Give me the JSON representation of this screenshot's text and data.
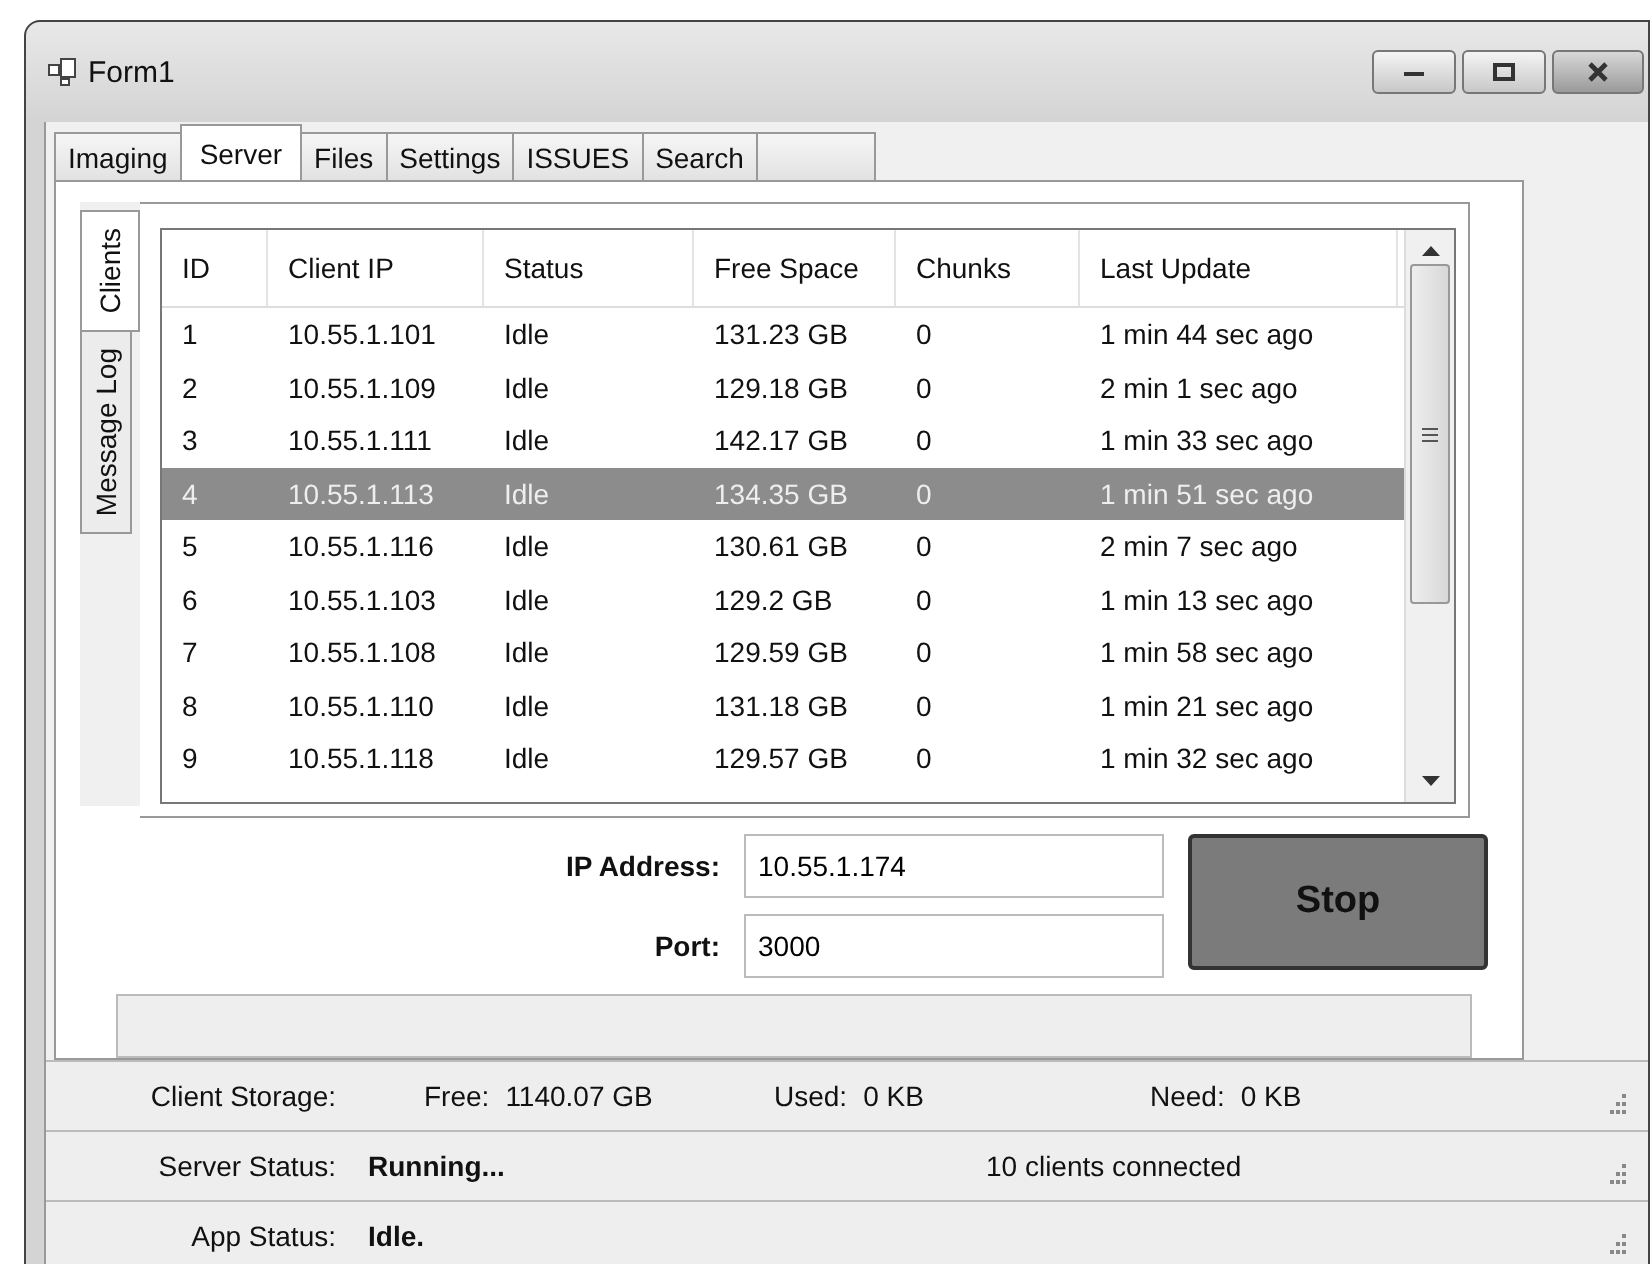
{
  "window": {
    "title": "Form1"
  },
  "tabs": [
    {
      "kind": "text",
      "label": "Imaging",
      "selected": false
    },
    {
      "kind": "text",
      "label": "Server",
      "selected": true
    },
    {
      "kind": "text",
      "label": "Files",
      "selected": false
    },
    {
      "kind": "text",
      "label": "Settings",
      "selected": false
    },
    {
      "kind": "text",
      "label": "ISSUES",
      "selected": false
    },
    {
      "kind": "text",
      "label": "Search",
      "selected": false
    },
    {
      "kind": "blank",
      "selected": false
    }
  ],
  "side_tabs": [
    {
      "label": "Clients",
      "selected": true
    },
    {
      "label": "Message Log",
      "selected": false
    }
  ],
  "table": {
    "columns": [
      "ID",
      "Client IP",
      "Status",
      "Free Space",
      "Chunks",
      "Last Update"
    ],
    "rows": [
      {
        "cells": [
          "1",
          "10.55.1.101",
          "Idle",
          "131.23 GB",
          "0",
          "1 min 44 sec ago"
        ],
        "selected": false
      },
      {
        "cells": [
          "2",
          "10.55.1.109",
          "Idle",
          "129.18 GB",
          "0",
          "2 min 1 sec ago"
        ],
        "selected": false
      },
      {
        "cells": [
          "3",
          "10.55.1.111",
          "Idle",
          "142.17 GB",
          "0",
          "1 min 33 sec ago"
        ],
        "selected": false
      },
      {
        "cells": [
          "4",
          "10.55.1.113",
          "Idle",
          "134.35 GB",
          "0",
          "1 min 51 sec ago"
        ],
        "selected": true
      },
      {
        "cells": [
          "5",
          "10.55.1.116",
          "Idle",
          "130.61 GB",
          "0",
          "2 min 7 sec ago"
        ],
        "selected": false
      },
      {
        "cells": [
          "6",
          "10.55.1.103",
          "Idle",
          "129.2 GB",
          "0",
          "1 min 13 sec ago"
        ],
        "selected": false
      },
      {
        "cells": [
          "7",
          "10.55.1.108",
          "Idle",
          "129.59 GB",
          "0",
          "1 min 58 sec ago"
        ],
        "selected": false
      },
      {
        "cells": [
          "8",
          "10.55.1.110",
          "Idle",
          "131.18 GB",
          "0",
          "1 min 21 sec ago"
        ],
        "selected": false
      },
      {
        "cells": [
          "9",
          "10.55.1.118",
          "Idle",
          "129.57 GB",
          "0",
          "1 min 32 sec ago"
        ],
        "selected": false
      }
    ]
  },
  "form": {
    "ip_label": "IP Address:",
    "ip_value": "10.55.1.174",
    "port_label": "Port:",
    "port_value": "3000",
    "button": "Stop"
  },
  "status_strips": [
    {
      "kind": "storage",
      "label": "Client Storage:",
      "fields": [
        {
          "name": "Free:",
          "value": "1140.07 GB"
        },
        {
          "name": "Used:",
          "value": "0 KB"
        },
        {
          "name": "Need:",
          "value": "0 KB"
        }
      ]
    },
    {
      "kind": "status",
      "label": "Server Status:",
      "value": "Running...",
      "note": "10 clients connected"
    },
    {
      "kind": "status",
      "label": "App Status:",
      "value": "Idle."
    }
  ]
}
